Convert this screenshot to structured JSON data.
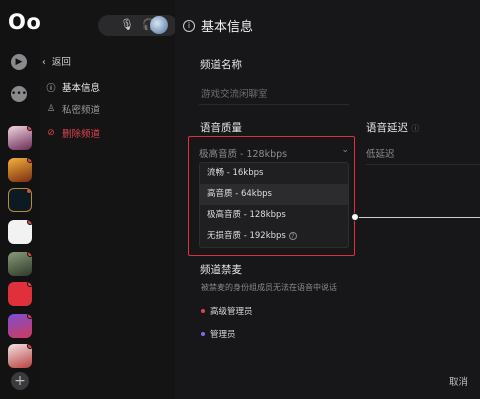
{
  "app": {
    "logo": "Oopz"
  },
  "toolbar": {
    "mic_icon": "↓",
    "headphone_icon": "◡"
  },
  "settings_nav": {
    "back_label": "返回",
    "items": [
      {
        "label": "基本信息",
        "state": "active",
        "icon": "info-icon"
      },
      {
        "label": "私密频道",
        "state": "normal",
        "icon": "person-lock-icon"
      },
      {
        "label": "删除频道",
        "state": "danger",
        "icon": "trash-icon"
      }
    ]
  },
  "page": {
    "title": "基本信息"
  },
  "channel_name": {
    "label": "频道名称",
    "placeholder": "游戏交流闲聊室"
  },
  "voice_quality": {
    "label": "语音质量",
    "selected": "极高音质 - 128kbps",
    "options": [
      {
        "label": "流畅 - 16kbps"
      },
      {
        "label": "高音质 - 64kbps"
      },
      {
        "label": "极高音质 - 128kbps"
      },
      {
        "label": "无损音质 - 192kbps"
      }
    ]
  },
  "voice_delay": {
    "label": "语音延迟",
    "value": "低延迟"
  },
  "channel_mute": {
    "label": "频道禁麦",
    "description": "被禁麦的身份组成员无法在语音中说话",
    "roles": [
      {
        "name": "高级管理员",
        "color": "#e0434f"
      },
      {
        "name": "管理员",
        "color": "#7b6cf0"
      }
    ]
  },
  "footer": {
    "cancel_label": "取消"
  },
  "colors": {
    "accent_red": "#e0303c",
    "danger": "#e0434f"
  }
}
